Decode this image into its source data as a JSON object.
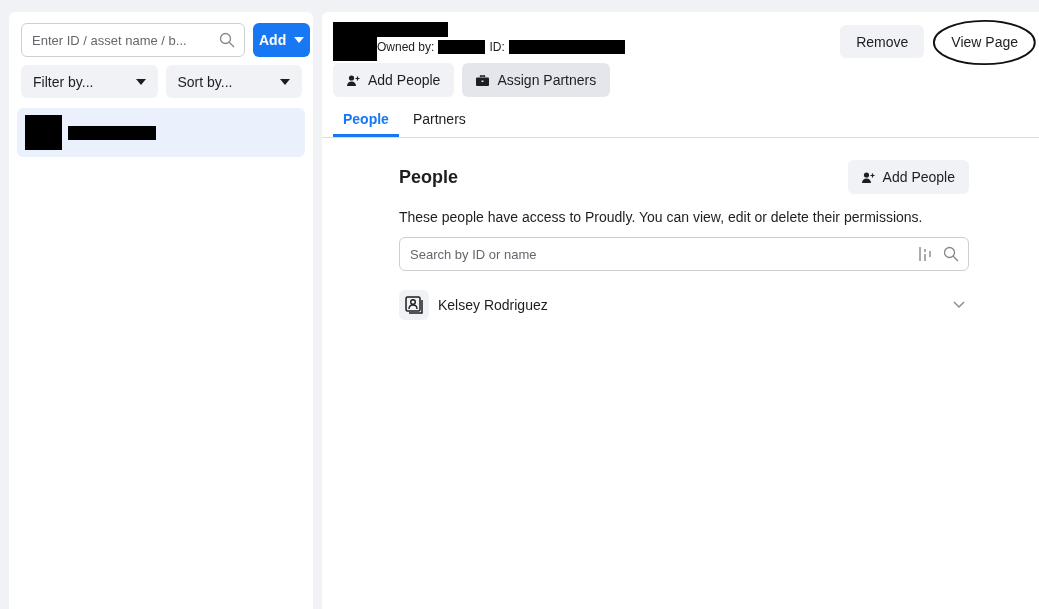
{
  "sidebar": {
    "search": {
      "placeholder": "Enter ID / asset name / b..."
    },
    "add_button": "Add",
    "filters": [
      {
        "label": "Filter by..."
      },
      {
        "label": "Sort by..."
      }
    ],
    "items": [
      {
        "selected": true
      }
    ]
  },
  "header": {
    "owned_by_label": "Owned by:",
    "id_label": "ID:",
    "buttons": [
      {
        "label": "Remove",
        "circled": false
      },
      {
        "label": "View Page",
        "circled": true
      }
    ],
    "actions": [
      {
        "label": "Add People",
        "kind": "person",
        "pressed": false
      },
      {
        "label": "Assign Partners",
        "kind": "briefcase",
        "pressed": true
      }
    ]
  },
  "tabs": [
    {
      "label": "People",
      "selected": true
    },
    {
      "label": "Partners",
      "selected": false
    }
  ],
  "people": {
    "title": "People",
    "add_button": "Add People",
    "description": "These people have access to Proudly. You can view, edit or delete their permissions.",
    "search": {
      "placeholder": "Search by ID or name"
    },
    "rows": [
      {
        "name": "Kelsey Rodriguez",
        "expanded": false
      }
    ]
  }
}
